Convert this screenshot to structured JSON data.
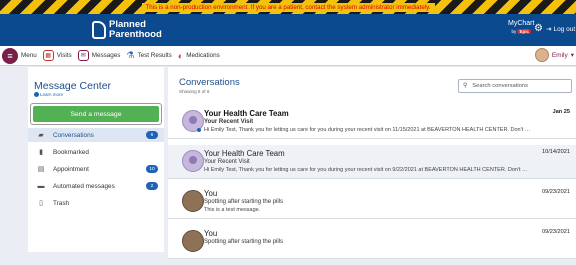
{
  "banner": {
    "text": "This is a non-production environment. If you are a patient, contact the system administrator immediately."
  },
  "header": {
    "logo_line1": "Planned",
    "logo_line2": "Parenthood",
    "mychart": "MyChart",
    "mychart_sub": "by",
    "mychart_brand": "Epic",
    "logout": "Log out"
  },
  "nav": {
    "items": [
      {
        "label": "Menu"
      },
      {
        "label": "Visits"
      },
      {
        "label": "Messages"
      },
      {
        "label": "Test Results"
      },
      {
        "label": "Medications"
      }
    ],
    "user": "Emily"
  },
  "sidebar": {
    "title": "Message Center",
    "learn_more": "Learn more",
    "send_button": "Send a message",
    "folders": [
      {
        "label": "Conversations",
        "count": "6"
      },
      {
        "label": "Bookmarked",
        "count": ""
      },
      {
        "label": "Appointment",
        "count": "10"
      },
      {
        "label": "Automated messages",
        "count": "2"
      },
      {
        "label": "Trash",
        "count": ""
      }
    ]
  },
  "main": {
    "title": "Conversations",
    "showing": "Showing 6 of 6",
    "search_placeholder": "Search conversations",
    "conversations": [
      {
        "from": "Your Health Care Team",
        "subject": "Your Recent Visit",
        "preview": "Hi Emily Test,  Thank you for letting us care for you during your recent visit on 11/15/2021 at BEAVERTON HEALTH CENTER. Don't …",
        "date": "Jan 25"
      },
      {
        "from": "Your Health Care Team",
        "subject": "Your Recent Visit",
        "preview": "Hi Emily Test,  Thank you for letting us care for you during your recent visit on 9/22/2021 at BEAVERTON HEALTH CENTER. Don't …",
        "date": "10/14/2021"
      },
      {
        "from": "You",
        "subject": "Spotting after starting the pills",
        "preview": "This is a test message.",
        "date": "09/23/2021"
      },
      {
        "from": "You",
        "subject": "Spotting after starting the pills",
        "preview": "",
        "date": "09/23/2021"
      }
    ]
  },
  "colors": {
    "header": "#0b4a8f",
    "accent": "#1f4f89",
    "send": "#52b153",
    "brand": "#7a1f4a"
  }
}
